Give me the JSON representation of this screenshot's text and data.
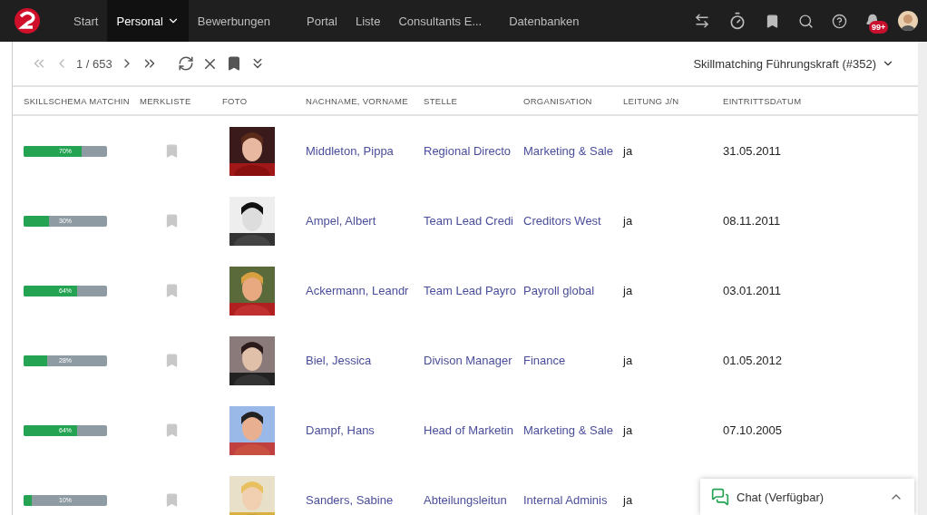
{
  "nav": {
    "items": [
      {
        "label": "Start",
        "selected": false,
        "dropdown": false
      },
      {
        "label": "Personal",
        "selected": true,
        "dropdown": true
      },
      {
        "label": "Bewerbungen",
        "selected": false,
        "dropdown": false
      },
      {
        "label": "Portal",
        "selected": false,
        "dropdown": false
      },
      {
        "label": "Liste",
        "selected": false,
        "dropdown": false
      },
      {
        "label": "Consultants E...",
        "selected": false,
        "dropdown": false
      },
      {
        "label": "Datenbanken",
        "selected": false,
        "dropdown": false
      }
    ],
    "notification_badge": "99+"
  },
  "toolbar": {
    "pager": "1 / 653",
    "view": "Skillmatching Führungskraft (#352)"
  },
  "table": {
    "columns": [
      "SKILLSCHEMA MATCHIN",
      "MERKLISTE",
      "FOTO",
      "NACHNAME, VORNAME",
      "STELLE",
      "ORGANISATION",
      "LEITUNG J/N",
      "EINTRITTSDATUM"
    ],
    "rows": [
      {
        "match": "70%",
        "level": 0.7,
        "bookmarked": false,
        "name": "Middleton, Pippa",
        "stelle": "Regional Directo",
        "organisation": "Marketing & Sale",
        "leitung": "ja",
        "eintritt": "31.05.2011"
      },
      {
        "match": "30%",
        "level": 0.3,
        "bookmarked": false,
        "name": "Ampel, Albert",
        "stelle": "Team Lead Credi",
        "organisation": "Creditors West",
        "leitung": "ja",
        "eintritt": "08.11.2011"
      },
      {
        "match": "64%",
        "level": 0.64,
        "bookmarked": false,
        "name": "Ackermann, Leandr",
        "stelle": "Team Lead Payro",
        "organisation": "Payroll global",
        "leitung": "ja",
        "eintritt": "03.01.2011"
      },
      {
        "match": "28%",
        "level": 0.28,
        "bookmarked": false,
        "name": "Biel, Jessica",
        "stelle": "Divison Manager",
        "organisation": "Finance",
        "leitung": "ja",
        "eintritt": "01.05.2012"
      },
      {
        "match": "64%",
        "level": 0.64,
        "bookmarked": false,
        "name": "Dampf, Hans",
        "stelle": "Head of Marketin",
        "organisation": "Marketing & Sale",
        "leitung": "ja",
        "eintritt": "07.10.2005"
      },
      {
        "match": "10%",
        "level": 0.1,
        "bookmarked": false,
        "name": "Sanders, Sabine",
        "stelle": "Abteilungsleitun",
        "organisation": "Internal Adminis",
        "leitung": "ja"
      }
    ]
  },
  "chat": {
    "label": "Chat (Verfügbar)"
  }
}
